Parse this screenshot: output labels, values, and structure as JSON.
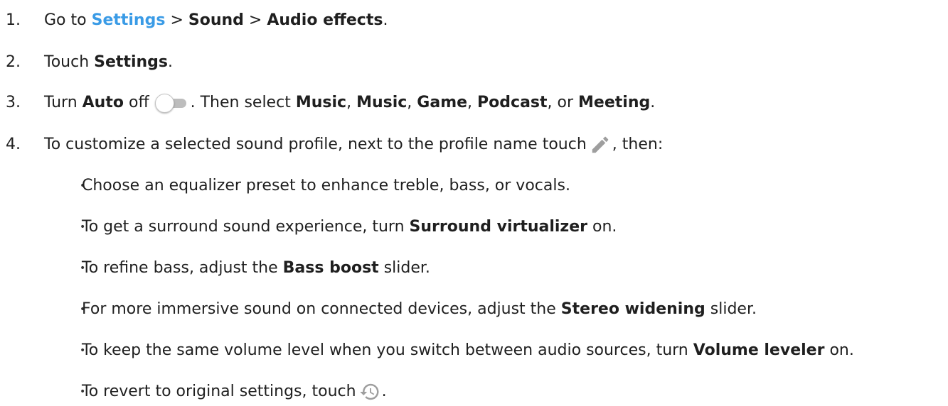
{
  "steps": [
    {
      "num": "1.",
      "go_to": "Go to",
      "settings_link": "Settings",
      "sep1": ">",
      "sound": "Sound",
      "sep2": ">",
      "audio_effects": "Audio effects",
      "end": "."
    },
    {
      "num": "2.",
      "text": "Touch",
      "settings": "Settings",
      "end": "."
    },
    {
      "num": "3.",
      "turn": "Turn",
      "auto": "Auto",
      "off": "off",
      "then_select": ". Then select",
      "music1": "Music",
      "music2": "Music",
      "game": "Game",
      "podcast": "Podcast",
      "or": ", or",
      "meeting": "Meeting",
      "comma": ",",
      "end": "."
    },
    {
      "num": "4.",
      "text": "To customize a selected sound profile, next to the profile name touch",
      "then": ", then:"
    }
  ],
  "bullets": [
    {
      "text": "Choose an equalizer preset to enhance treble, bass, or vocals."
    },
    {
      "pre": "To get a surround sound experience, turn",
      "bold": "Surround virtualizer",
      "post": "on."
    },
    {
      "pre": "To refine bass, adjust the",
      "bold": "Bass boost",
      "post": "slider."
    },
    {
      "pre": "For more immersive sound on connected devices, adjust the",
      "bold": "Stereo widening",
      "post": "slider."
    },
    {
      "pre": "To keep the same volume level when you switch between audio sources, turn",
      "bold": "Volume leveler",
      "post": "on."
    },
    {
      "pre": "To revert to original settings, touch",
      "post": "."
    }
  ],
  "bullet_char": "•",
  "icons": {
    "toggle": "toggle-off-icon",
    "edit": "pencil-icon",
    "reset": "history-icon"
  },
  "colors": {
    "link": "#3a9be6",
    "text": "#1f1f1f"
  }
}
